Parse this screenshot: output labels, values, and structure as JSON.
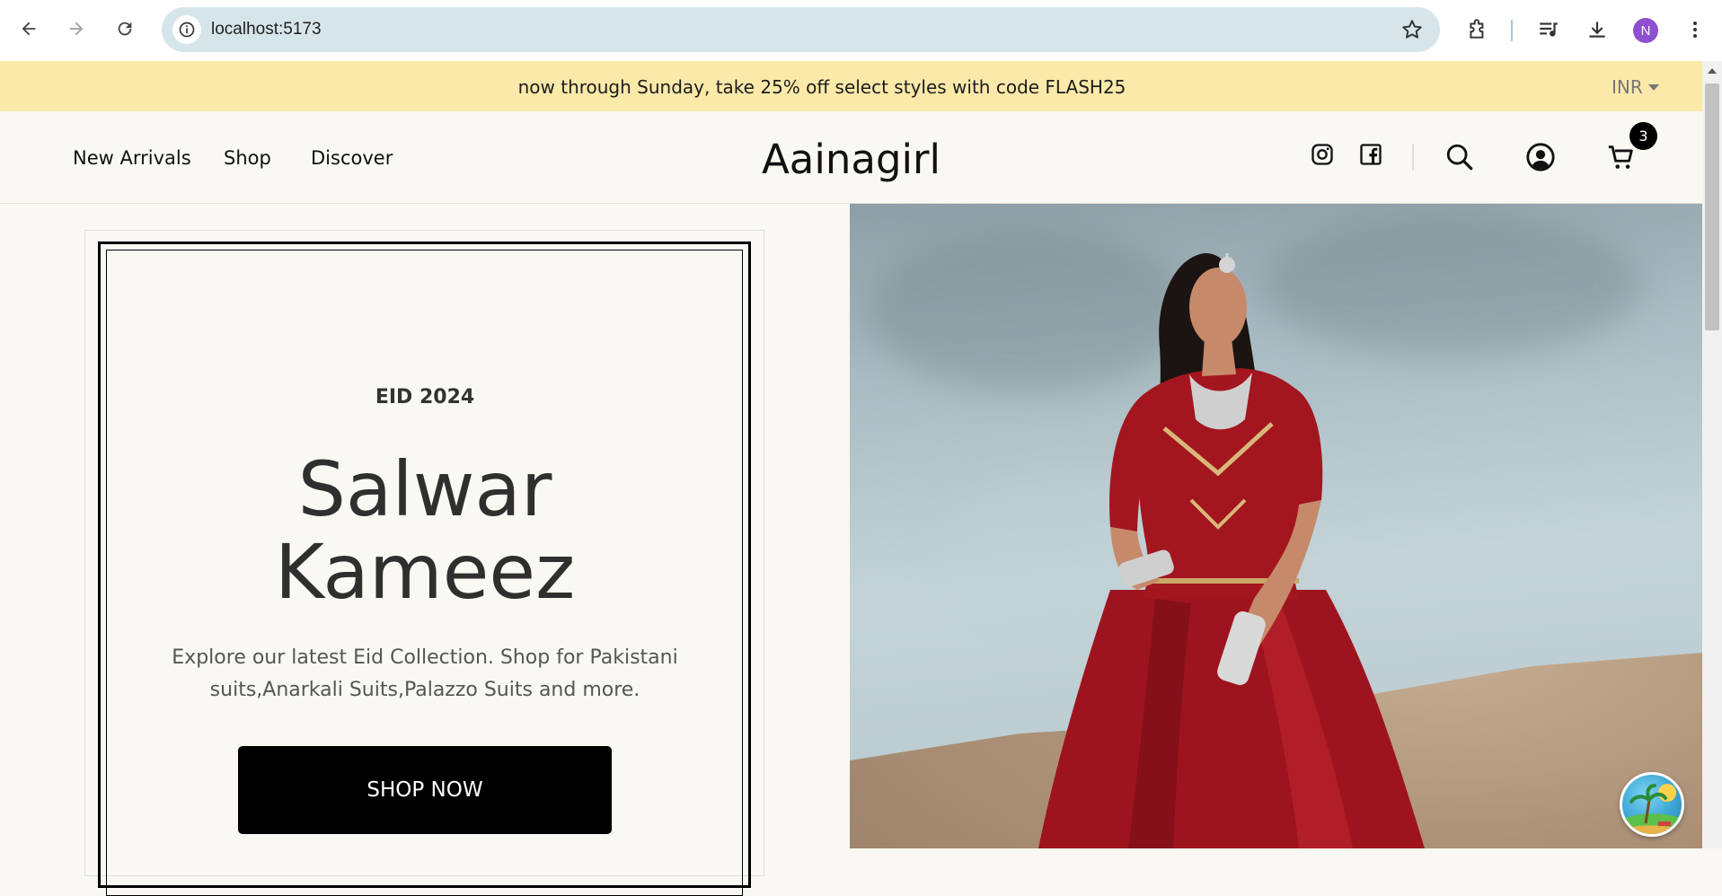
{
  "browser": {
    "url": "localhost:5173",
    "profile_initial": "N"
  },
  "announcement": {
    "text": "now through Sunday, take 25% off select styles with code FLASH25",
    "currency": "INR"
  },
  "header": {
    "menu": [
      "New Arrivals",
      "Shop",
      "Discover"
    ],
    "brand": "Aainagirl",
    "cart_count": "3"
  },
  "hero": {
    "eyebrow": "EID 2024",
    "title_line1": "Salwar",
    "title_line2": "Kameez",
    "description": "Explore our latest Eid Collection. Shop for Pakistani suits,Anarkali Suits,Palazzo Suits and more.",
    "cta": "SHOP NOW"
  },
  "colors": {
    "announcement_bg": "#fbe9a9",
    "page_bg": "#faf8f2",
    "cta_bg": "#000000",
    "dress_red": "#a3161f"
  }
}
